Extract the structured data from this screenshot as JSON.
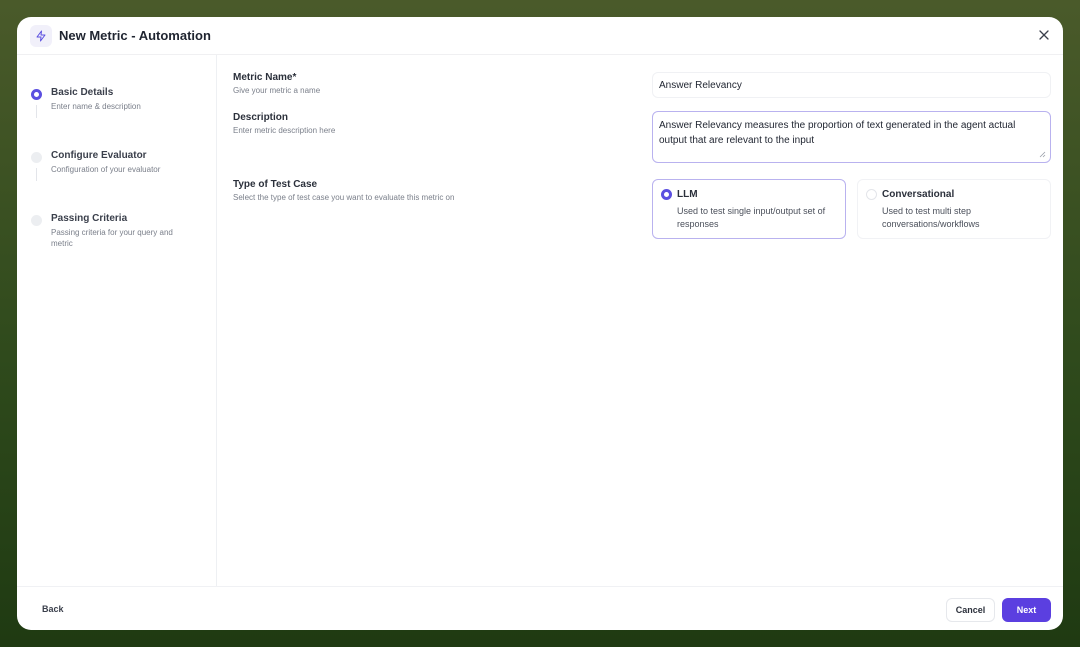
{
  "header": {
    "title": "New Metric - Automation",
    "icon": "lightning-icon"
  },
  "steps": [
    {
      "title": "Basic Details",
      "desc": "Enter name & description",
      "active": true
    },
    {
      "title": "Configure Evaluator",
      "desc": "Configuration of your evaluator",
      "active": false
    },
    {
      "title": "Passing Criteria",
      "desc": "Passing criteria for your query and metric",
      "active": false
    }
  ],
  "form": {
    "metric_name": {
      "label": "Metric Name*",
      "hint": "Give your metric a name",
      "value": "Answer Relevancy"
    },
    "description": {
      "label": "Description",
      "hint": "Enter metric description here",
      "value": "Answer Relevancy measures the proportion of text generated in the agent actual output that are relevant to the input"
    },
    "test_case_type": {
      "label": "Type of Test Case",
      "hint": "Select the type of test case you want to evaluate this metric on",
      "options": [
        {
          "title": "LLM",
          "desc": "Used to test single input/output set of responses",
          "selected": true
        },
        {
          "title": "Conversational",
          "desc": "Used to test multi step conversations/workflows",
          "selected": false
        }
      ]
    }
  },
  "footer": {
    "back_label": "Back",
    "cancel_label": "Cancel",
    "next_label": "Next"
  },
  "colors": {
    "accent": "#5b3fe0",
    "selected_border": "#b9b2ef"
  }
}
